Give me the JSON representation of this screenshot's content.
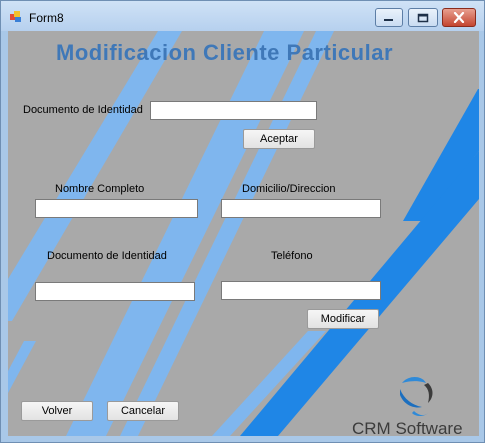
{
  "window": {
    "title": "Form8"
  },
  "form": {
    "heading": "Modificacion Cliente Particular",
    "search_label": "Documento de Identidad",
    "search_value": "",
    "accept_label": "Aceptar",
    "name_label": "Nombre Completo",
    "name_value": "",
    "address_label": "Domicilio/Direccion",
    "address_value": "",
    "document_label": "Documento de Identidad",
    "document_value": "",
    "phone_label": "Teléfono",
    "phone_value": "",
    "modify_label": "Modificar",
    "back_label": "Volver",
    "cancel_label": "Cancelar"
  },
  "branding": {
    "logo_text": "CRM Software"
  },
  "colors": {
    "client_bg": "#a9a9a9",
    "stripe_light": "#7fb6ee",
    "stripe_dark": "#1f86e6",
    "heading": "#3f78b8"
  },
  "icons": [
    "app-icon",
    "minimize-icon",
    "maximize-icon",
    "close-icon",
    "crm-logo-icon"
  ]
}
